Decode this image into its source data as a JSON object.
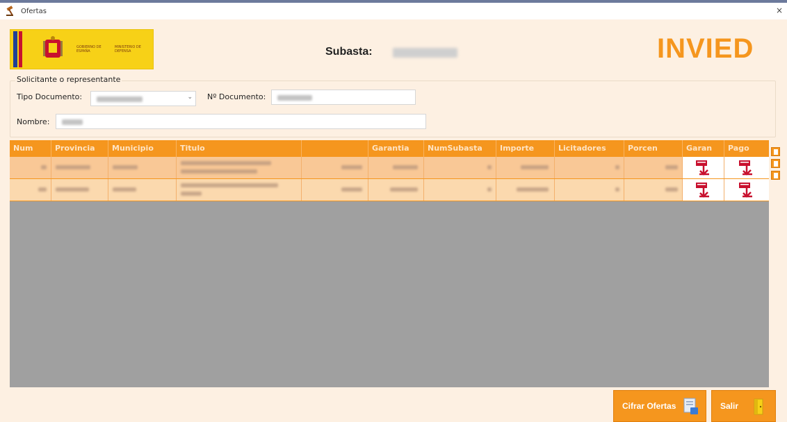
{
  "window": {
    "title": "Ofertas",
    "close_glyph": "×"
  },
  "logo": {
    "line1": "GOBIERNO DE ESPAÑA",
    "line2": "MINISTERIO DE DEFENSA"
  },
  "header": {
    "subasta_label": "Subasta:",
    "brand": "INVIED"
  },
  "solicitante": {
    "legend": "Solicitante o representante",
    "tipo_documento_label": "Tipo Documento:",
    "num_documento_label": "Nº Documento:",
    "nombre_label": "Nombre:"
  },
  "grid": {
    "columns": [
      "Num",
      "Provincia",
      "Municipio",
      "Titulo",
      "",
      "Garantia",
      "NumSubasta",
      "Importe",
      "Licitadores",
      "Porcen",
      "Garan",
      "Pago"
    ],
    "rows": [
      {
        "garan_icon": "pdf-icon",
        "pago_icon": "pdf-icon"
      },
      {
        "garan_icon": "pdf-icon",
        "pago_icon": "pdf-icon"
      }
    ]
  },
  "buttons": {
    "cifrar": "Cifrar Ofertas",
    "salir": "Salir"
  },
  "colors": {
    "accent": "#f5961e",
    "background": "#fdf0e2",
    "grid_empty": "#a0a0a0",
    "row1": "#f9c896",
    "row2": "#fbd9ae"
  }
}
